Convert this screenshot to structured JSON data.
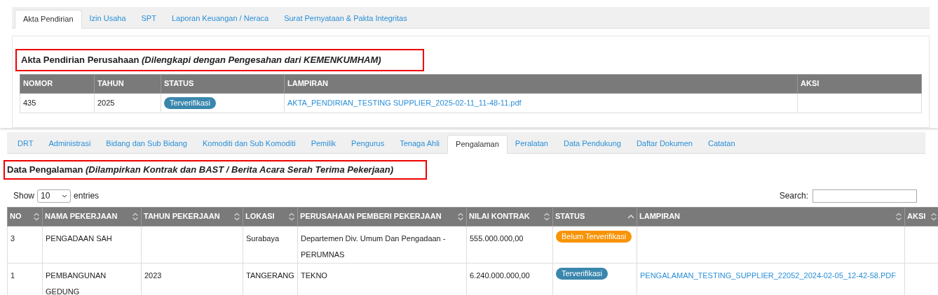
{
  "top_tabs": [
    {
      "label": "Akta Pendirian",
      "selected": true
    },
    {
      "label": "Izin Usaha",
      "selected": false
    },
    {
      "label": "SPT",
      "selected": false
    },
    {
      "label": "Laporan Keuangan / Neraca",
      "selected": false
    },
    {
      "label": "Surat Pernyataan & Pakta Integritas",
      "selected": false
    }
  ],
  "akta": {
    "heading": "Akta Pendirian Perusahaan *(Dilengkapi dengan Pengesahan dari KEMENKUMHAM)*",
    "columns": [
      "NOMOR",
      "TAHUN",
      "STATUS",
      "LAMPIRAN",
      "AKSI"
    ],
    "rows": [
      {
        "nomor": "435",
        "tahun": "2025",
        "status": {
          "label": "Terverifikasi",
          "kind": "verified"
        },
        "lampiran": "AKTA_PENDIRIAN_TESTING SUPPLIER_2025-02-11_11-48-11.pdf"
      }
    ]
  },
  "tabs": [
    {
      "label": "DRT",
      "selected": false
    },
    {
      "label": "Administrasi",
      "selected": false
    },
    {
      "label": "Bidang dan Sub Bidang",
      "selected": false
    },
    {
      "label": "Komoditi dan Sub Komoditi",
      "selected": false
    },
    {
      "label": "Pemilik",
      "selected": false
    },
    {
      "label": "Pengurus",
      "selected": false
    },
    {
      "label": "Tenaga Ahli",
      "selected": false
    },
    {
      "label": "Pengalaman",
      "selected": true
    },
    {
      "label": "Peralatan",
      "selected": false
    },
    {
      "label": "Data Pendukung",
      "selected": false
    },
    {
      "label": "Daftar Dokumen",
      "selected": false
    },
    {
      "label": "Catatan",
      "selected": false
    }
  ],
  "pengalaman": {
    "heading": "Data Pengalaman *(Dilampirkan Kontrak dan BAST / Berita Acara Serah Terima Pekerjaan)*",
    "show_label": "Show",
    "page_size": "10",
    "entries_label": "entries",
    "search_label": "Search:",
    "columns": [
      {
        "label": "NO",
        "sorted": false
      },
      {
        "label": "NAMA PEKERJAAN",
        "sorted": false
      },
      {
        "label": "TAHUN PEKERJAAN",
        "sorted": false
      },
      {
        "label": "LOKASI",
        "sorted": false
      },
      {
        "label": "PERUSAHAAN PEMBERI PEKERJAAN",
        "sorted": false
      },
      {
        "label": "NILAI KONTRAK",
        "sorted": false
      },
      {
        "label": "STATUS",
        "sorted": true
      },
      {
        "label": "LAMPIRAN",
        "sorted": false
      },
      {
        "label": "AKSI",
        "sorted": false
      }
    ],
    "rows": [
      {
        "no": "3",
        "nama": "PENGADAAN SAH",
        "tahun": "",
        "lokasi": "Surabaya",
        "perusahaan": "Departemen Div. Umum Dan Pengadaan - PERUMNAS",
        "nilai": "555.000.000,00",
        "status": {
          "label": "Belum Terverifikasi",
          "kind": "unverified"
        },
        "lampiran": ""
      },
      {
        "no": "1",
        "nama": "PEMBANGUNAN GEDUNG",
        "tahun": "2023",
        "lokasi": "TANGERANG",
        "perusahaan": "TEKNO",
        "nilai": "6.240.000.000,00",
        "status": {
          "label": "Terverifikasi",
          "kind": "verified"
        },
        "lampiran": "PENGALAMAN_TESTING_SUPPLIER_22052_2024-02-05_12-42-58.PDF"
      }
    ]
  }
}
